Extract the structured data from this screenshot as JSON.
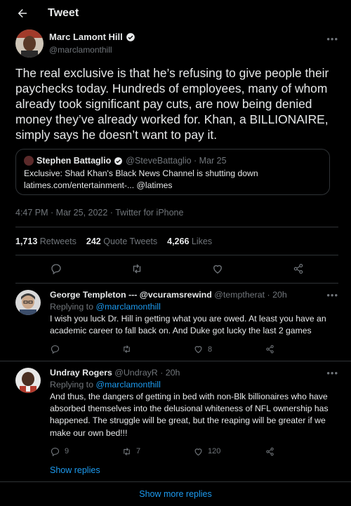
{
  "header": {
    "title": "Tweet"
  },
  "main_tweet": {
    "author_name": "Marc Lamont Hill",
    "author_handle": "@marclamonthill",
    "text": "The real exclusive is that he’s refusing to give people their paychecks today. Hundreds of employees, many of whom already took significant pay cuts, are now being denied money they’ve already worked for. Khan, a BILLIONAIRE, simply says he doesn’t want to pay it.",
    "quote": {
      "author_name": "Stephen Battaglio",
      "meta": "@SteveBattaglio · Mar 25",
      "line1": "Exclusive: Shad Khan's Black News Channel is shutting down",
      "line2": "latimes.com/entertainment-... @latimes"
    },
    "timestamp": "4:47 PM · Mar 25, 2022 · Twitter for iPhone",
    "retweets": "1,713",
    "retweets_label": "Retweets",
    "quotes": "242",
    "quotes_label": "Quote Tweets",
    "likes": "4,266",
    "likes_label": "Likes"
  },
  "replies": [
    {
      "author_name": "George Templeton --- @vcuramsrewind",
      "meta": "@temptherat · 20h",
      "replying_prefix": "Replying to",
      "replying_to": "@marclamonthill",
      "text": "I wish you luck Dr. Hill in getting what you are owed. At least you have an academic career to fall back on. And Duke got lucky the last 2 games",
      "reply_count": "",
      "retweet_count": "",
      "like_count": "8"
    },
    {
      "author_name": "Undray Rogers",
      "meta": "@UndrayR · 20h",
      "replying_prefix": "Replying to",
      "replying_to": "@marclamonthill",
      "text": "And thus, the dangers of getting in bed with non-Blk billionaires who have absorbed themselves into the delusional whiteness of NFL ownership has happened. The struggle will be great, but the reaping will be greater if we make our own bed!!!",
      "reply_count": "9",
      "retweet_count": "7",
      "like_count": "120"
    }
  ],
  "show_replies": "Show replies",
  "show_more_replies": "Show more replies",
  "colors": {
    "background": "#000000",
    "text": "#e7e9ea",
    "muted": "#71767b",
    "accent": "#1d9bf0",
    "border": "#2f3336"
  }
}
